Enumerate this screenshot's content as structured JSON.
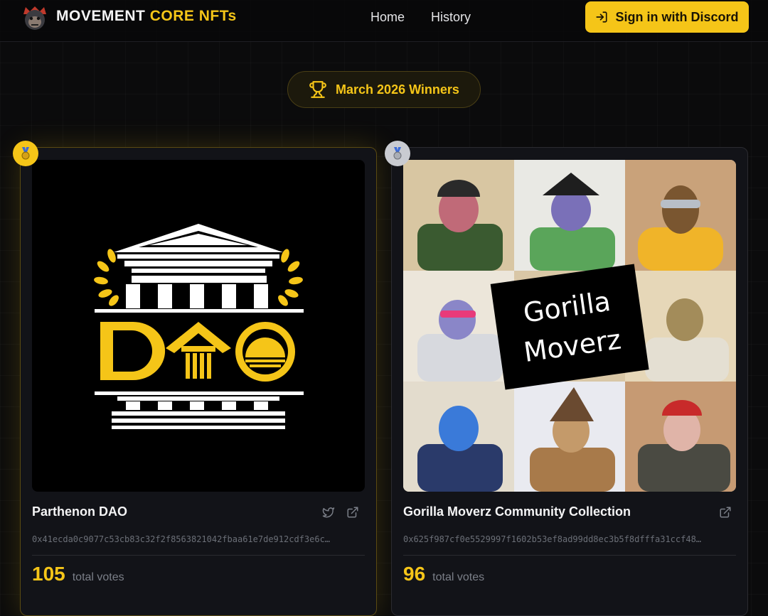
{
  "header": {
    "brand_primary": "MOVEMENT",
    "brand_accent": "CORE NFTs",
    "logo_icon": "gorilla-logo-icon",
    "nav": [
      "Home",
      "History"
    ],
    "signin_label": "Sign in with Discord",
    "signin_icon": "login-arrow-icon"
  },
  "banner": {
    "label": "March 2026 Winners",
    "icon": "trophy-icon"
  },
  "colors": {
    "accent": "#f5c518",
    "background": "#0b0b0c",
    "card": "#121318"
  },
  "winners": [
    {
      "rank": 1,
      "medal": "gold-medal-icon",
      "image_text": "DAO",
      "title": "Parthenon DAO",
      "address": "0x41ecda0c9077c53cb83c32f2f8563821042fbaa61e7de912cdf3e6c…",
      "votes": "105",
      "votes_label": "total votes",
      "links": [
        "twitter-icon",
        "external-link-icon"
      ]
    },
    {
      "rank": 2,
      "medal": "silver-medal-icon",
      "image_text": [
        "Gorilla",
        "Moverz"
      ],
      "title": "Gorilla Moverz Community Collection",
      "address": "0x625f987cf0e5529997f1602b53ef8ad99dd8ec3b5f8dfffa31ccf48…",
      "votes": "96",
      "votes_label": "total votes",
      "links": [
        "external-link-icon"
      ]
    }
  ]
}
